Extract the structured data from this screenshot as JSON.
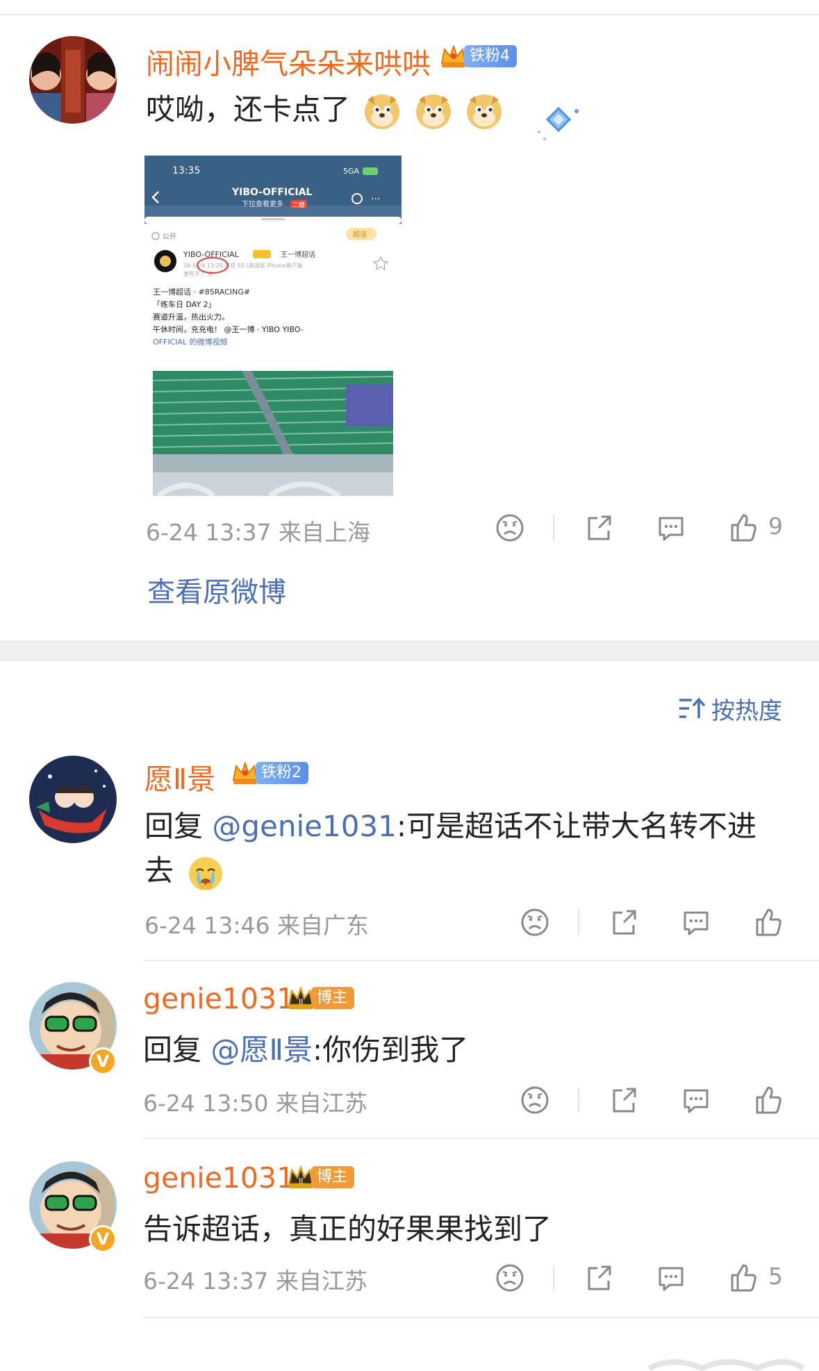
{
  "post": {
    "author": {
      "name": "闹闹小脾气朵朵来哄哄",
      "badge": "铁粉4"
    },
    "text": "哎呦，还卡点了",
    "emoji_icon": "doge-emoji",
    "emoji_count": 3,
    "meta": "6-24 13:37  来自上海",
    "like_count": "9",
    "view_original": "查看原微博",
    "embedded_screenshot": {
      "time": "13:35",
      "network": "5GA",
      "title": "YIBO-OFFICIAL",
      "subtitle": "下拉查看更多",
      "subtitle_badge": "二楼",
      "visibility": "公开",
      "corner_tag": "超话",
      "post_author": "YIBO-OFFICIAL",
      "post_supertopic": "王一博超话",
      "post_meta": "26-6-24 13:28  来自 85 (高温版 iPhone客户端",
      "post_meta_sub": "发布于 广东",
      "line1": "王一博超话 · #85RACING#",
      "line2": "「练车日 DAY 2」",
      "line3": "赛道升温，热出火力。",
      "line4": "午休时间，充充电！ @王一博 · YIBO  YIBO-",
      "line5": "OFFICIAL 的微博视频"
    }
  },
  "sort": {
    "label": "按热度"
  },
  "comments": [
    {
      "name": "愿Ⅱ景",
      "badge": "铁粉2",
      "reply_prefix": "回复 ",
      "mention": "@genie1031",
      "text_line1": ":可是超话不让带大名转不进",
      "text_line2": "去",
      "emoji_icon": "crying-face-emoji",
      "meta": "6-24 13:46  来自广东",
      "like_count": ""
    },
    {
      "name": "genie1031",
      "badge": "博主",
      "reply_prefix": "回复 ",
      "mention": "@愿Ⅱ景",
      "text_line1": ":你伤到我了",
      "meta": "6-24 13:50  来自江苏",
      "like_count": ""
    },
    {
      "name": "genie1031",
      "badge": "博主",
      "text_line1": "告诉超话，真正的好果果找到了",
      "meta": "6-24 13:37  来自江苏",
      "like_count": "5"
    }
  ],
  "colors": {
    "username": "#ef6a21",
    "link": "#4a6fb5",
    "meta": "#999999",
    "fan_badge": "#6b9cee",
    "host_badge": "#f19a38"
  }
}
